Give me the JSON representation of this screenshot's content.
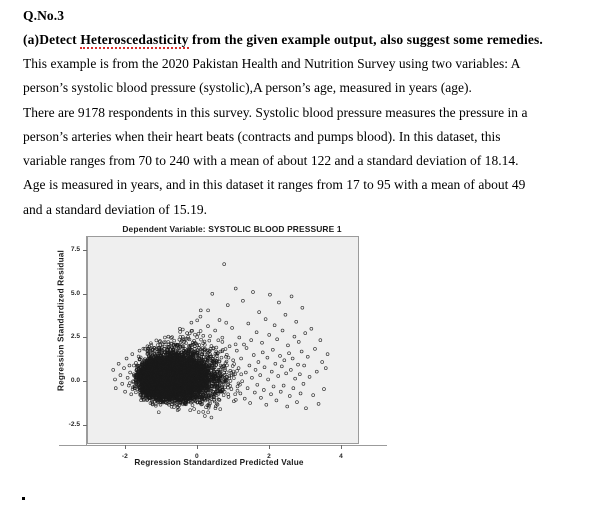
{
  "document": {
    "question_number": "Q.No.3",
    "part_label": "(a)Detect ",
    "spellchecked_word": "Heteroscedasticity",
    "part_rest": " from the given example output, also suggest some remedies.",
    "paragraph_lines": [
      "This example is from the 2020 Pakistan Health and Nutrition Survey using two variables: A",
      "person’s systolic blood pressure (systolic),A person’s age, measured in years (age).",
      "There are 9178 respondents in this survey. Systolic blood pressure measures the pressure in a",
      "person’s arteries when their heart beats (contracts and pumps blood). In this dataset, this",
      "variable ranges from 70 to 240 with a mean of about 122 and a standard deviation of 18.14.",
      "Age is measured in years, and in this dataset it ranges from 17 to 95 with a mean of about 49",
      "and a standard deviation of 15.19."
    ],
    "trailing_mark": "."
  },
  "chart_data": {
    "type": "scatter",
    "title": "Dependent Variable: SYSTOLIC BLOOD PRESSURE 1",
    "xlabel": "Regression Standardized Predicted Value",
    "ylabel": "Regression Standardized Residual",
    "xlim": [
      -3.05,
      4.5
    ],
    "ylim": [
      -3.6,
      8.3
    ],
    "xticks": [
      -2,
      0,
      2,
      4
    ],
    "xticklabels": [
      "-2",
      "0",
      "2",
      "4"
    ],
    "yticks": [
      -2.5,
      0.0,
      2.5,
      5.0,
      7.5
    ],
    "yticklabels": [
      "-2.5",
      "0.0",
      "2.5",
      "5.0",
      "7.5"
    ],
    "grid": false,
    "legend": false,
    "n_points": 9178,
    "marker": "open-circle",
    "marker_color": "#1a1a1a",
    "panel_background": "#efefef",
    "pattern": "funnel / fan-shaped spread widening with predicted value (heteroscedasticity), right-skewed positive residual tail",
    "points": [
      [
        -2.35,
        0.7
      ],
      [
        -2.3,
        0.15
      ],
      [
        -2.28,
        -0.35
      ],
      [
        -2.2,
        1.05
      ],
      [
        -2.15,
        0.4
      ],
      [
        -2.1,
        -0.1
      ],
      [
        -2.05,
        0.8
      ],
      [
        -2.02,
        -0.55
      ],
      [
        -1.98,
        1.35
      ],
      [
        -1.95,
        0.25
      ],
      [
        -1.92,
        -0.2
      ],
      [
        -1.9,
        0.95
      ],
      [
        -1.88,
        0.55
      ],
      [
        -1.85,
        -0.7
      ],
      [
        -1.82,
        1.6
      ],
      [
        -1.8,
        0.05
      ],
      [
        -1.78,
        0.45
      ],
      [
        -1.75,
        -0.35
      ],
      [
        -1.72,
        1.1
      ],
      [
        -1.7,
        0.7
      ],
      [
        -1.68,
        -0.15
      ],
      [
        -1.65,
        0.3
      ],
      [
        -1.62,
        1.8
      ],
      [
        -1.6,
        -0.6
      ],
      [
        -1.58,
        0.9
      ],
      [
        -1.55,
        0.2
      ],
      [
        -1.52,
        -0.4
      ],
      [
        -1.5,
        1.25
      ],
      [
        -1.48,
        0.6
      ],
      [
        -1.45,
        -0.05
      ],
      [
        -1.42,
        0.85
      ],
      [
        -1.4,
        2.05
      ],
      [
        -1.38,
        -0.75
      ],
      [
        -1.35,
        0.35
      ],
      [
        -1.32,
        1.45
      ],
      [
        -1.3,
        -0.25
      ],
      [
        -1.28,
        0.75
      ],
      [
        -1.25,
        0.1
      ],
      [
        -1.22,
        -0.5
      ],
      [
        -1.2,
        1.95
      ],
      [
        -1.18,
        0.5
      ],
      [
        -1.15,
        -0.85
      ],
      [
        -1.12,
        1.3
      ],
      [
        -1.1,
        0.0
      ],
      [
        -1.08,
        0.65
      ],
      [
        -1.05,
        2.35
      ],
      [
        -1.02,
        -0.3
      ],
      [
        -1.0,
        1.0
      ],
      [
        -0.98,
        0.4
      ],
      [
        -0.95,
        -0.65
      ],
      [
        -0.92,
        1.7
      ],
      [
        -0.9,
        0.2
      ],
      [
        -0.88,
        -1.0
      ],
      [
        -0.85,
        0.95
      ],
      [
        -0.82,
        2.6
      ],
      [
        -0.8,
        -0.45
      ],
      [
        -0.78,
        1.15
      ],
      [
        -0.75,
        0.55
      ],
      [
        -0.72,
        -0.2
      ],
      [
        -0.7,
        1.85
      ],
      [
        -0.68,
        0.3
      ],
      [
        -0.65,
        -0.9
      ],
      [
        -0.62,
        2.15
      ],
      [
        -0.6,
        0.8
      ],
      [
        -0.58,
        -0.35
      ],
      [
        -0.55,
        1.4
      ],
      [
        -0.52,
        0.1
      ],
      [
        -0.5,
        3.05
      ],
      [
        -0.48,
        -0.7
      ],
      [
        -0.45,
        0.6
      ],
      [
        -0.42,
        2.45
      ],
      [
        -0.4,
        -0.15
      ],
      [
        -0.38,
        1.2
      ],
      [
        -0.35,
        0.45
      ],
      [
        -0.32,
        -1.05
      ],
      [
        -0.3,
        2.8
      ],
      [
        -0.28,
        0.85
      ],
      [
        -0.25,
        -0.5
      ],
      [
        -0.22,
        1.6
      ],
      [
        -0.2,
        0.25
      ],
      [
        -0.18,
        3.4
      ],
      [
        -0.15,
        -0.8
      ],
      [
        -0.12,
        1.05
      ],
      [
        -0.1,
        0.5
      ],
      [
        -0.08,
        -0.25
      ],
      [
        -0.05,
        2.2
      ],
      [
        -0.02,
        0.7
      ],
      [
        0.0,
        -1.15
      ],
      [
        0.03,
        1.5
      ],
      [
        0.05,
        0.15
      ],
      [
        0.08,
        4.1
      ],
      [
        0.1,
        -0.6
      ],
      [
        0.13,
        0.95
      ],
      [
        0.15,
        2.65
      ],
      [
        0.18,
        -0.3
      ],
      [
        0.2,
        1.3
      ],
      [
        0.23,
        0.4
      ],
      [
        0.25,
        -0.95
      ],
      [
        0.28,
        3.2
      ],
      [
        0.3,
        0.75
      ],
      [
        0.33,
        -0.45
      ],
      [
        0.35,
        1.9
      ],
      [
        0.38,
        0.2
      ],
      [
        0.4,
        5.05
      ],
      [
        0.43,
        -0.7
      ],
      [
        0.45,
        1.1
      ],
      [
        0.48,
        2.95
      ],
      [
        0.5,
        -0.2
      ],
      [
        0.53,
        0.6
      ],
      [
        0.55,
        1.65
      ],
      [
        0.58,
        -1.0
      ],
      [
        0.6,
        3.55
      ],
      [
        0.63,
        0.35
      ],
      [
        0.65,
        -0.55
      ],
      [
        0.68,
        2.3
      ],
      [
        0.7,
        0.9
      ],
      [
        0.73,
        6.75
      ],
      [
        0.75,
        -0.3
      ],
      [
        0.78,
        1.45
      ],
      [
        0.8,
        0.1
      ],
      [
        0.83,
        4.4
      ],
      [
        0.85,
        -0.85
      ],
      [
        0.88,
        2.05
      ],
      [
        0.9,
        0.65
      ],
      [
        0.93,
        -0.4
      ],
      [
        0.95,
        3.1
      ],
      [
        0.98,
        1.25
      ],
      [
        1.0,
        -1.1
      ],
      [
        1.03,
        0.45
      ],
      [
        1.05,
        5.35
      ],
      [
        1.08,
        1.8
      ],
      [
        1.1,
        -0.25
      ],
      [
        1.13,
        0.8
      ],
      [
        1.15,
        2.55
      ],
      [
        1.18,
        -0.65
      ],
      [
        1.2,
        1.35
      ],
      [
        1.23,
        0.05
      ],
      [
        1.25,
        4.65
      ],
      [
        1.28,
        2.15
      ],
      [
        1.3,
        -0.95
      ],
      [
        1.33,
        0.55
      ],
      [
        1.35,
        1.95
      ],
      [
        1.38,
        -0.35
      ],
      [
        1.4,
        3.35
      ],
      [
        1.43,
        0.95
      ],
      [
        1.45,
        -1.2
      ],
      [
        1.48,
        2.4
      ],
      [
        1.5,
        0.25
      ],
      [
        1.53,
        5.15
      ],
      [
        1.55,
        1.55
      ],
      [
        1.58,
        -0.6
      ],
      [
        1.6,
        0.7
      ],
      [
        1.63,
        2.85
      ],
      [
        1.65,
        -0.15
      ],
      [
        1.68,
        1.15
      ],
      [
        1.7,
        4.0
      ],
      [
        1.73,
        0.4
      ],
      [
        1.75,
        -0.9
      ],
      [
        1.78,
        2.25
      ],
      [
        1.8,
        1.7
      ],
      [
        1.83,
        -0.45
      ],
      [
        1.85,
        0.85
      ],
      [
        1.88,
        3.6
      ],
      [
        1.9,
        -1.3
      ],
      [
        1.93,
        1.4
      ],
      [
        1.95,
        0.15
      ],
      [
        1.98,
        2.7
      ],
      [
        2.0,
        5.0
      ],
      [
        2.03,
        -0.7
      ],
      [
        2.05,
        0.6
      ],
      [
        2.08,
        1.85
      ],
      [
        2.1,
        -0.25
      ],
      [
        2.13,
        3.25
      ],
      [
        2.15,
        1.05
      ],
      [
        2.18,
        -1.05
      ],
      [
        2.2,
        2.45
      ],
      [
        2.23,
        0.35
      ],
      [
        2.25,
        4.55
      ],
      [
        2.28,
        1.5
      ],
      [
        2.3,
        -0.55
      ],
      [
        2.33,
        0.9
      ],
      [
        2.35,
        2.95
      ],
      [
        2.38,
        -0.2
      ],
      [
        2.4,
        1.25
      ],
      [
        2.43,
        3.85
      ],
      [
        2.45,
        0.5
      ],
      [
        2.48,
        -1.4
      ],
      [
        2.5,
        2.1
      ],
      [
        2.53,
        1.65
      ],
      [
        2.55,
        -0.8
      ],
      [
        2.58,
        0.7
      ],
      [
        2.6,
        4.9
      ],
      [
        2.63,
        1.35
      ],
      [
        2.65,
        -0.35
      ],
      [
        2.68,
        2.6
      ],
      [
        2.7,
        0.2
      ],
      [
        2.73,
        3.45
      ],
      [
        2.75,
        -1.15
      ],
      [
        2.78,
        1.0
      ],
      [
        2.8,
        2.3
      ],
      [
        2.83,
        0.45
      ],
      [
        2.85,
        -0.65
      ],
      [
        2.88,
        1.75
      ],
      [
        2.9,
        4.25
      ],
      [
        2.93,
        -0.1
      ],
      [
        2.95,
        0.95
      ],
      [
        2.98,
        2.8
      ],
      [
        3.0,
        -1.5
      ],
      [
        3.05,
        1.45
      ],
      [
        3.1,
        0.3
      ],
      [
        3.15,
        3.05
      ],
      [
        3.2,
        -0.75
      ],
      [
        3.25,
        1.9
      ],
      [
        3.3,
        0.6
      ],
      [
        3.35,
        -1.25
      ],
      [
        3.4,
        2.4
      ],
      [
        3.45,
        1.15
      ],
      [
        3.5,
        -0.4
      ],
      [
        3.55,
        0.8
      ],
      [
        3.6,
        1.6
      ]
    ]
  }
}
